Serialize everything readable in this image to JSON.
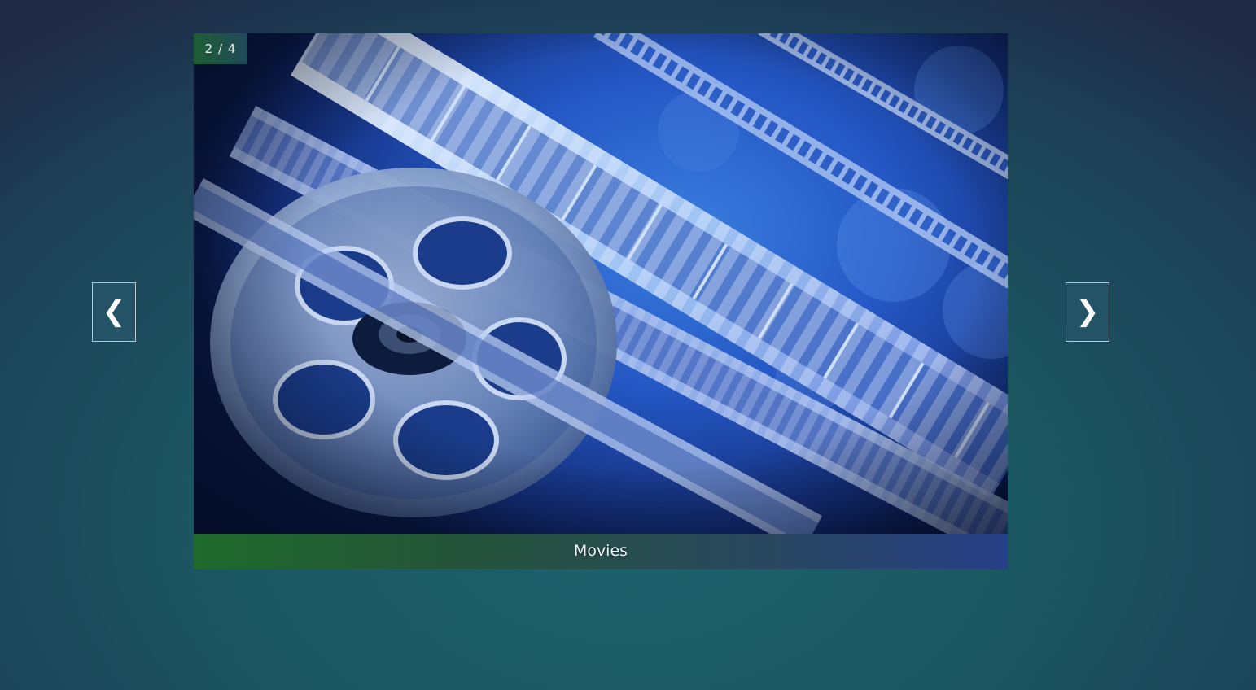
{
  "slideshow": {
    "counter": "2 / 4",
    "caption": "Movies",
    "prev_glyph": "❮",
    "next_glyph": "❯",
    "current_slide": 2,
    "total_slides": 4,
    "image_subject": "film-reel-and-filmstrip"
  },
  "colors": {
    "counter_bg_start": "#1f5e35",
    "counter_bg_end": "#214a5c",
    "caption_bg_start": "#1f6a2c",
    "caption_bg_end": "#263f87",
    "nav_bg": "#245266",
    "page_bg": "#1b5661"
  },
  "icons": {
    "prev": "chevron-left-icon",
    "next": "chevron-right-icon"
  }
}
